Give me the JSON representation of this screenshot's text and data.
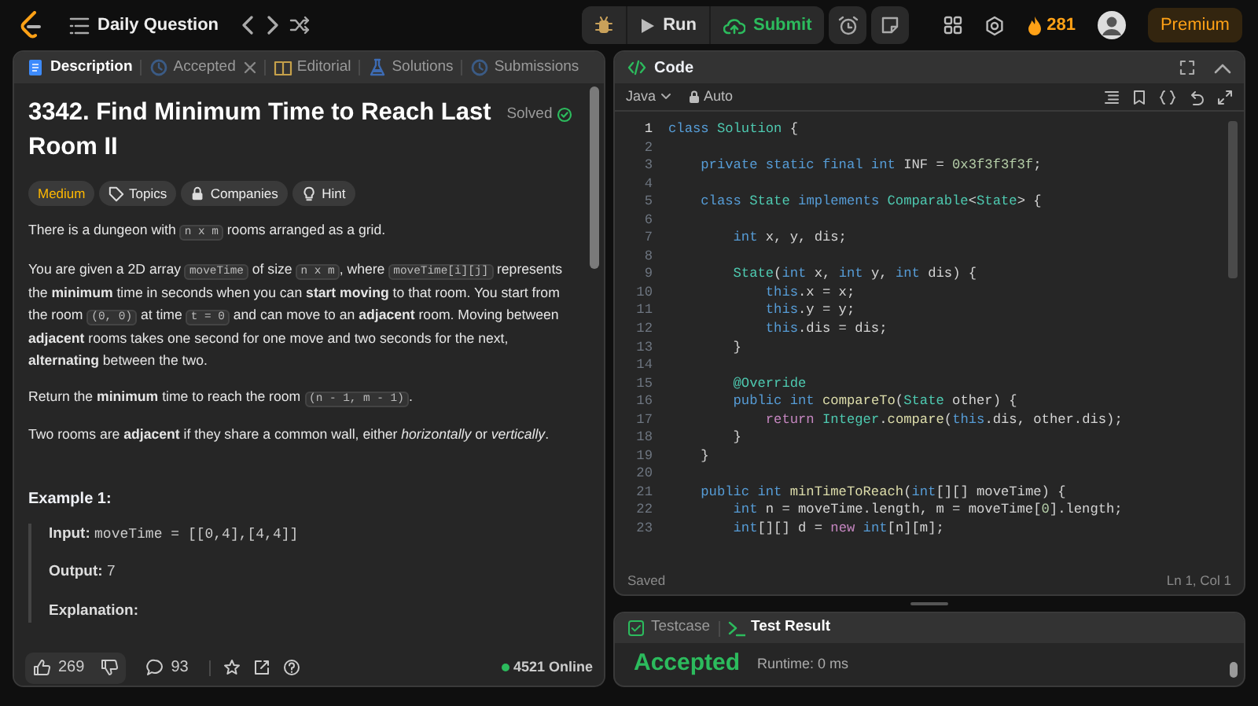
{
  "topbar": {
    "title": "Daily Question",
    "run": "Run",
    "submit": "Submit",
    "streak": "281",
    "premium": "Premium"
  },
  "description_tabs": [
    {
      "label": "Description",
      "kind": "description",
      "selected": true,
      "closable": false
    },
    {
      "label": "Accepted",
      "kind": "accepted",
      "selected": false,
      "closable": true
    },
    {
      "label": "Editorial",
      "kind": "editorial",
      "selected": false,
      "closable": false
    },
    {
      "label": "Solutions",
      "kind": "solutions",
      "selected": false,
      "closable": false
    },
    {
      "label": "Submissions",
      "kind": "submissions",
      "selected": false,
      "closable": false
    }
  ],
  "problem": {
    "title": "3342. Find Minimum Time to Reach Last Room II",
    "status": "Solved",
    "difficulty": "Medium",
    "tags": [
      {
        "label": "Topics",
        "kind": "tag"
      },
      {
        "label": "Companies",
        "kind": "lock"
      },
      {
        "label": "Hint",
        "kind": "bulb"
      }
    ],
    "paragraphs": [
      [
        {
          "kind": "text",
          "text": "There is a dungeon with "
        },
        {
          "kind": "code",
          "text": "n x m"
        },
        {
          "kind": "text",
          "text": " rooms arranged as a grid."
        }
      ],
      [
        {
          "kind": "text",
          "text": "You are given a 2D array "
        },
        {
          "kind": "code",
          "text": "moveTime"
        },
        {
          "kind": "text",
          "text": " of size "
        },
        {
          "kind": "code",
          "text": "n x m"
        },
        {
          "kind": "text",
          "text": ", where "
        },
        {
          "kind": "code",
          "text": "moveTime[i][j]"
        },
        {
          "kind": "text",
          "text": " represents the **minimum** time in seconds when you can **start moving** to that room. You start from the room "
        },
        {
          "kind": "code",
          "text": "(0, 0)"
        },
        {
          "kind": "text",
          "text": " at time "
        },
        {
          "kind": "code",
          "text": "t = 0"
        },
        {
          "kind": "text",
          "text": " and can move to an **adjacent** room. Moving between **adjacent** rooms takes one second for one move and two seconds for the next, **alternating** between the two."
        }
      ],
      [
        {
          "kind": "text",
          "text": "Return the **minimum** time to reach the room "
        },
        {
          "kind": "code",
          "text": "(n - 1, m - 1)"
        },
        {
          "kind": "text",
          "text": "."
        }
      ],
      [
        {
          "kind": "text",
          "text": "Two rooms are **adjacent** if they share a common wall, either *horizontally* or *vertically*."
        }
      ]
    ],
    "example": {
      "heading": "Example 1:",
      "rows": [
        {
          "label": "Input:",
          "value": "moveTime = [[0,4],[4,4]]",
          "mono": true
        },
        {
          "label": "Output:",
          "value": "7",
          "mono": false
        },
        {
          "label": "Explanation:"
        }
      ]
    }
  },
  "description_footer": {
    "likes": "269",
    "comments": "93",
    "online": "4521 Online"
  },
  "code_panel": {
    "title": "Code",
    "language": "Java",
    "mode": "Auto",
    "status": "Saved",
    "cursor": "Ln 1, Col 1",
    "lines": [
      {
        "n": "1",
        "current": true,
        "tokens": [
          {
            "kind": "kw",
            "text": "class "
          },
          {
            "kind": "type",
            "text": "Solution"
          },
          {
            "kind": "plain",
            "text": " {"
          }
        ]
      },
      {
        "n": "2",
        "current": false
      },
      {
        "n": "3",
        "current": false,
        "tokens": [
          {
            "kind": "kw",
            "text": "    private static final int"
          },
          {
            "kind": "plain",
            "text": " INF = "
          },
          {
            "kind": "num",
            "text": "0x3f3f3f3f"
          },
          {
            "kind": "plain",
            "text": ";"
          }
        ]
      },
      {
        "n": "4",
        "current": false
      },
      {
        "n": "5",
        "current": false,
        "tokens": [
          {
            "kind": "kw",
            "text": "    class "
          },
          {
            "kind": "type",
            "text": "State "
          },
          {
            "kind": "kw",
            "text": "implements "
          },
          {
            "kind": "type",
            "text": "Comparable"
          },
          {
            "kind": "plain",
            "text": "<"
          },
          {
            "kind": "type",
            "text": "State"
          },
          {
            "kind": "plain",
            "text": "> {"
          }
        ]
      },
      {
        "n": "6",
        "current": false
      },
      {
        "n": "7",
        "current": false,
        "tokens": [
          {
            "kind": "kw",
            "text": "        int"
          },
          {
            "kind": "plain",
            "text": " x, y, dis;"
          }
        ]
      },
      {
        "n": "8",
        "current": false
      },
      {
        "n": "9",
        "current": false,
        "tokens": [
          {
            "kind": "type",
            "text": "        State"
          },
          {
            "kind": "plain",
            "text": "("
          },
          {
            "kind": "kw",
            "text": "int"
          },
          {
            "kind": "plain",
            "text": " x, "
          },
          {
            "kind": "kw",
            "text": "int"
          },
          {
            "kind": "plain",
            "text": " y, "
          },
          {
            "kind": "kw",
            "text": "int"
          },
          {
            "kind": "plain",
            "text": " dis) {"
          }
        ]
      },
      {
        "n": "10",
        "current": false,
        "tokens": [
          {
            "kind": "kw",
            "text": "            this"
          },
          {
            "kind": "plain",
            "text": ".x = x;"
          }
        ]
      },
      {
        "n": "11",
        "current": false,
        "tokens": [
          {
            "kind": "kw",
            "text": "            this"
          },
          {
            "kind": "plain",
            "text": ".y = y;"
          }
        ]
      },
      {
        "n": "12",
        "current": false,
        "tokens": [
          {
            "kind": "kw",
            "text": "            this"
          },
          {
            "kind": "plain",
            "text": ".dis = dis;"
          }
        ]
      },
      {
        "n": "13",
        "current": false,
        "tokens": [
          {
            "kind": "plain",
            "text": "        }"
          }
        ]
      },
      {
        "n": "14",
        "current": false
      },
      {
        "n": "15",
        "current": false,
        "tokens": [
          {
            "kind": "ann",
            "text": "        @Override"
          }
        ]
      },
      {
        "n": "16",
        "current": false,
        "tokens": [
          {
            "kind": "kw",
            "text": "        public int "
          },
          {
            "kind": "fn",
            "text": "compareTo"
          },
          {
            "kind": "plain",
            "text": "("
          },
          {
            "kind": "type",
            "text": "State"
          },
          {
            "kind": "plain",
            "text": " other) {"
          }
        ]
      },
      {
        "n": "17",
        "current": false,
        "tokens": [
          {
            "kind": "ctl",
            "text": "            return "
          },
          {
            "kind": "type",
            "text": "Integer"
          },
          {
            "kind": "plain",
            "text": "."
          },
          {
            "kind": "fn",
            "text": "compare"
          },
          {
            "kind": "plain",
            "text": "("
          },
          {
            "kind": "kw",
            "text": "this"
          },
          {
            "kind": "plain",
            "text": ".dis, other.dis);"
          }
        ]
      },
      {
        "n": "18",
        "current": false,
        "tokens": [
          {
            "kind": "plain",
            "text": "        }"
          }
        ]
      },
      {
        "n": "19",
        "current": false,
        "tokens": [
          {
            "kind": "plain",
            "text": "    }"
          }
        ]
      },
      {
        "n": "20",
        "current": false
      },
      {
        "n": "21",
        "current": false,
        "tokens": [
          {
            "kind": "kw",
            "text": "    public int "
          },
          {
            "kind": "fn",
            "text": "minTimeToReach"
          },
          {
            "kind": "plain",
            "text": "("
          },
          {
            "kind": "kw",
            "text": "int"
          },
          {
            "kind": "plain",
            "text": "[][] moveTime) {"
          }
        ]
      },
      {
        "n": "22",
        "current": false,
        "tokens": [
          {
            "kind": "kw",
            "text": "        int"
          },
          {
            "kind": "plain",
            "text": " n = moveTime.length, m = moveTime["
          },
          {
            "kind": "num",
            "text": "0"
          },
          {
            "kind": "plain",
            "text": "].length;"
          }
        ]
      },
      {
        "n": "23",
        "current": false,
        "tokens": [
          {
            "kind": "kw",
            "text": "        int"
          },
          {
            "kind": "plain",
            "text": "[][] d = "
          },
          {
            "kind": "ctl",
            "text": "new "
          },
          {
            "kind": "kw",
            "text": "int"
          },
          {
            "kind": "plain",
            "text": "[n][m];"
          }
        ]
      }
    ]
  },
  "test_panel": {
    "tabs": [
      {
        "label": "Testcase",
        "kind": "testcase",
        "selected": false
      },
      {
        "label": "Test Result",
        "kind": "result",
        "selected": true
      }
    ],
    "verdict": "Accepted",
    "runtime": "Runtime: 0 ms"
  }
}
